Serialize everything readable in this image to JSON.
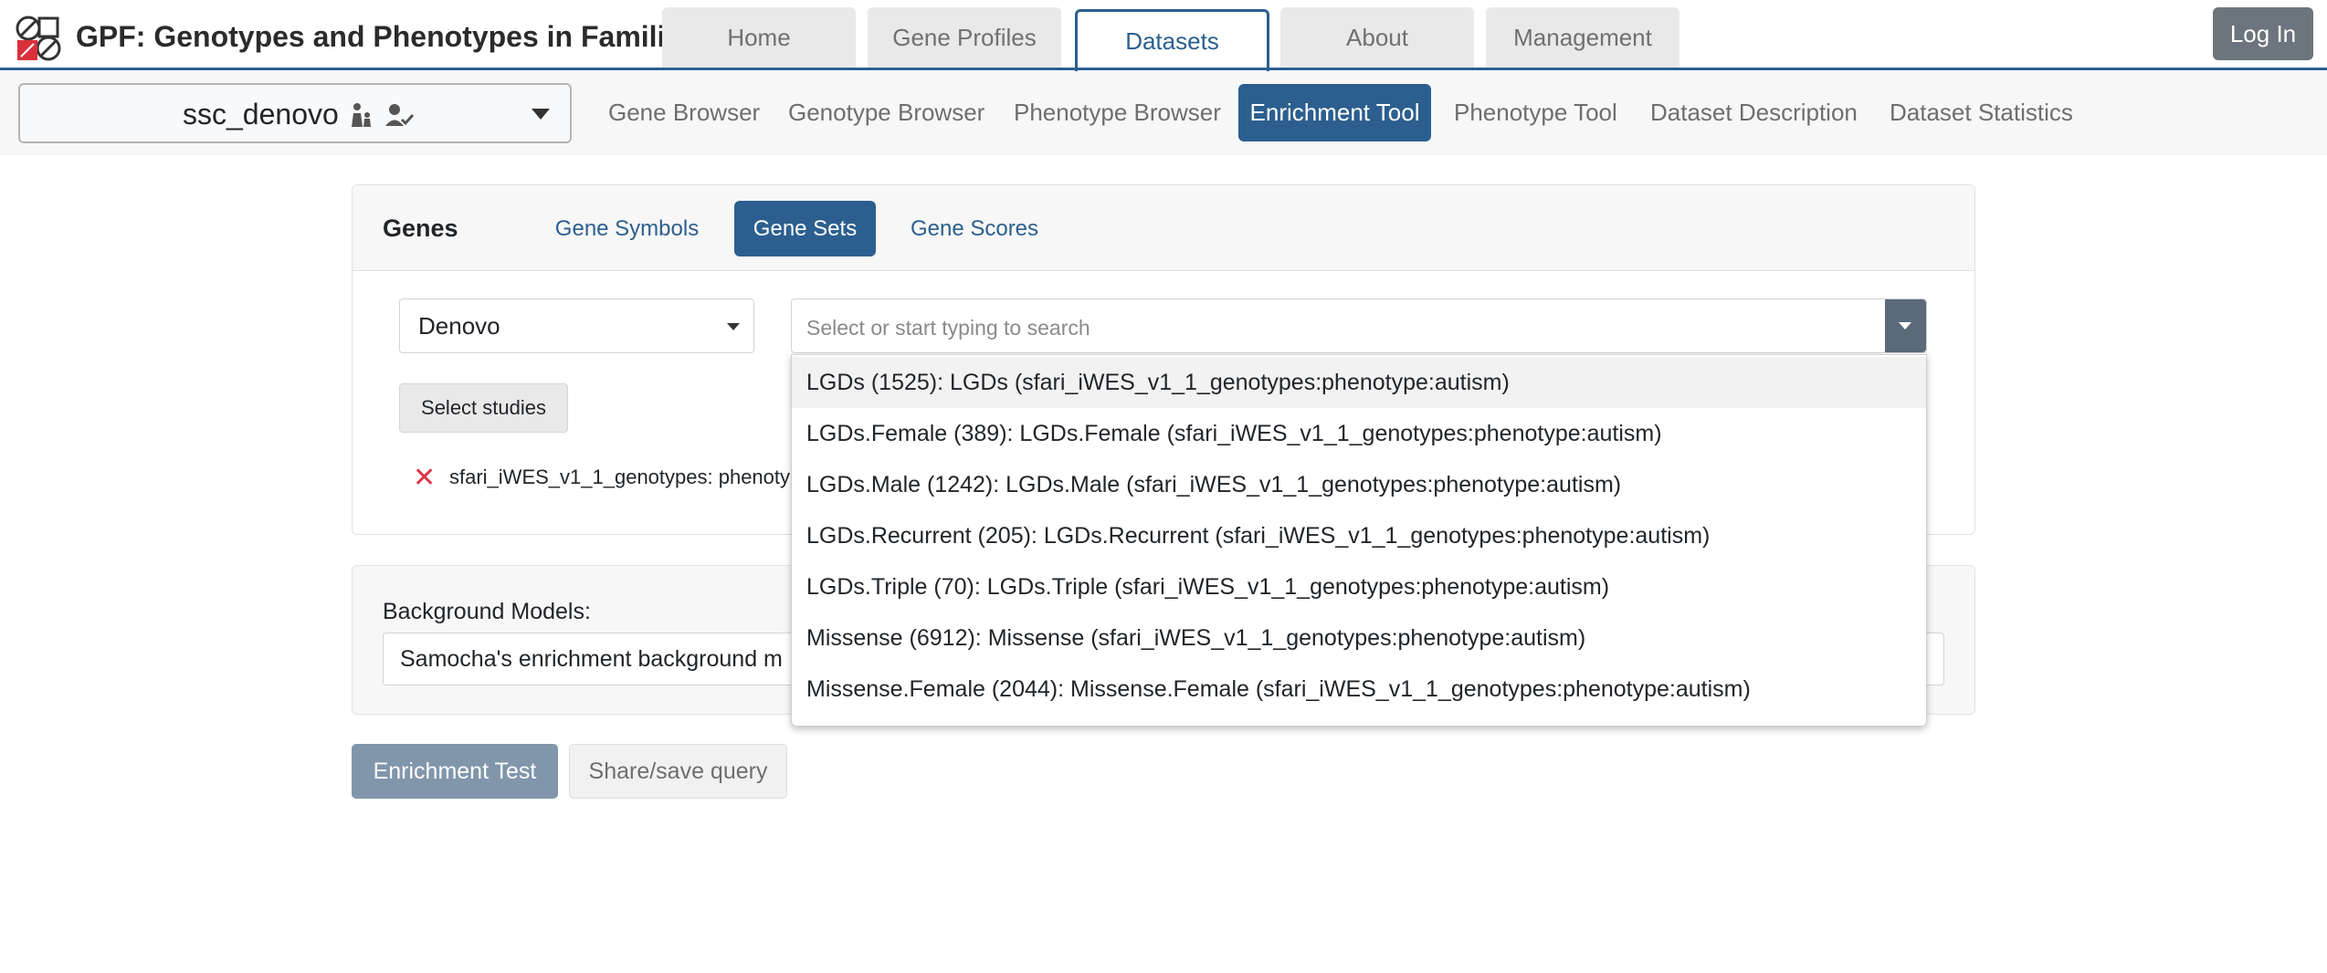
{
  "header": {
    "title": "GPF: Genotypes and Phenotypes in Families",
    "tabs": [
      {
        "label": "Home",
        "active": false
      },
      {
        "label": "Gene Profiles",
        "active": false
      },
      {
        "label": "Datasets",
        "active": true
      },
      {
        "label": "About",
        "active": false
      },
      {
        "label": "Management",
        "active": false
      }
    ],
    "login_label": "Log In"
  },
  "dataset_selector": {
    "value": "ssc_denovo",
    "icons": [
      "family-icon",
      "person-check-icon"
    ]
  },
  "subnav": {
    "tabs": [
      {
        "label": "Gene Browser",
        "active": false
      },
      {
        "label": "Genotype Browser",
        "active": false
      },
      {
        "label": "Phenotype Browser",
        "active": false
      },
      {
        "label": "Enrichment Tool",
        "active": true
      },
      {
        "label": "Phenotype Tool",
        "active": false
      },
      {
        "label": "Dataset Description",
        "active": false
      },
      {
        "label": "Dataset Statistics",
        "active": false
      }
    ]
  },
  "genes": {
    "title": "Genes",
    "tabs": [
      {
        "label": "Gene Symbols",
        "active": false
      },
      {
        "label": "Gene Sets",
        "active": true
      },
      {
        "label": "Gene Scores",
        "active": false
      }
    ],
    "collection_value": "Denovo",
    "select_studies_label": "Select studies",
    "selected_study": "sfari_iWES_v1_1_genotypes: phenoty",
    "search": {
      "value": "",
      "placeholder": "Select or start typing to search"
    },
    "dropdown_items": [
      "LGDs (1525): LGDs (sfari_iWES_v1_1_genotypes:phenotype:autism)",
      "LGDs.Female (389): LGDs.Female (sfari_iWES_v1_1_genotypes:phenotype:autism)",
      "LGDs.Male (1242): LGDs.Male (sfari_iWES_v1_1_genotypes:phenotype:autism)",
      "LGDs.Recurrent (205): LGDs.Recurrent (sfari_iWES_v1_1_genotypes:phenotype:autism)",
      "LGDs.Triple (70): LGDs.Triple (sfari_iWES_v1_1_genotypes:phenotype:autism)",
      "Missense (6912): Missense (sfari_iWES_v1_1_genotypes:phenotype:autism)",
      "Missense.Female (2044): Missense.Female (sfari_iWES_v1_1_genotypes:phenotype:autism)"
    ]
  },
  "background": {
    "label": "Background Models:",
    "value": "Samocha's enrichment background m"
  },
  "actions": {
    "enrichment_test_label": "Enrichment Test",
    "share_label": "Share/save query"
  },
  "colors": {
    "primary": "#2c5f8f",
    "danger": "#dc3545",
    "secondary": "#6c757d"
  }
}
